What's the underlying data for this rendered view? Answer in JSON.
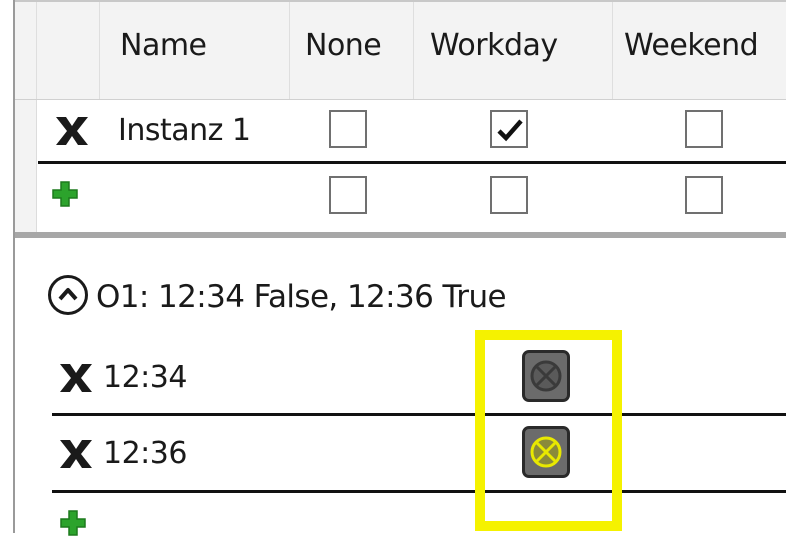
{
  "grid": {
    "columns": [
      "Name",
      "None",
      "Workday",
      "Weekend"
    ],
    "rows": [
      {
        "name": "Instanz 1",
        "none": false,
        "workday": true,
        "weekend": false
      },
      {
        "name": "",
        "none": false,
        "workday": false,
        "weekend": false
      }
    ]
  },
  "section": {
    "title": "O1: 12:34 False, 12:36 True",
    "entries": [
      {
        "time": "12:34",
        "state": "off"
      },
      {
        "time": "12:36",
        "state": "on"
      }
    ]
  },
  "icons": {
    "delete": "close-x-icon",
    "add": "green-plus-icon",
    "collapse": "chevron-up-circle-icon",
    "check": "checkmark-icon",
    "state_toggle": "circle-x-icon"
  },
  "colors": {
    "highlight": "#f5f200",
    "add_green": "#2ca32c",
    "state_on": "#e8e800",
    "state_off": "#4a4a4a"
  }
}
